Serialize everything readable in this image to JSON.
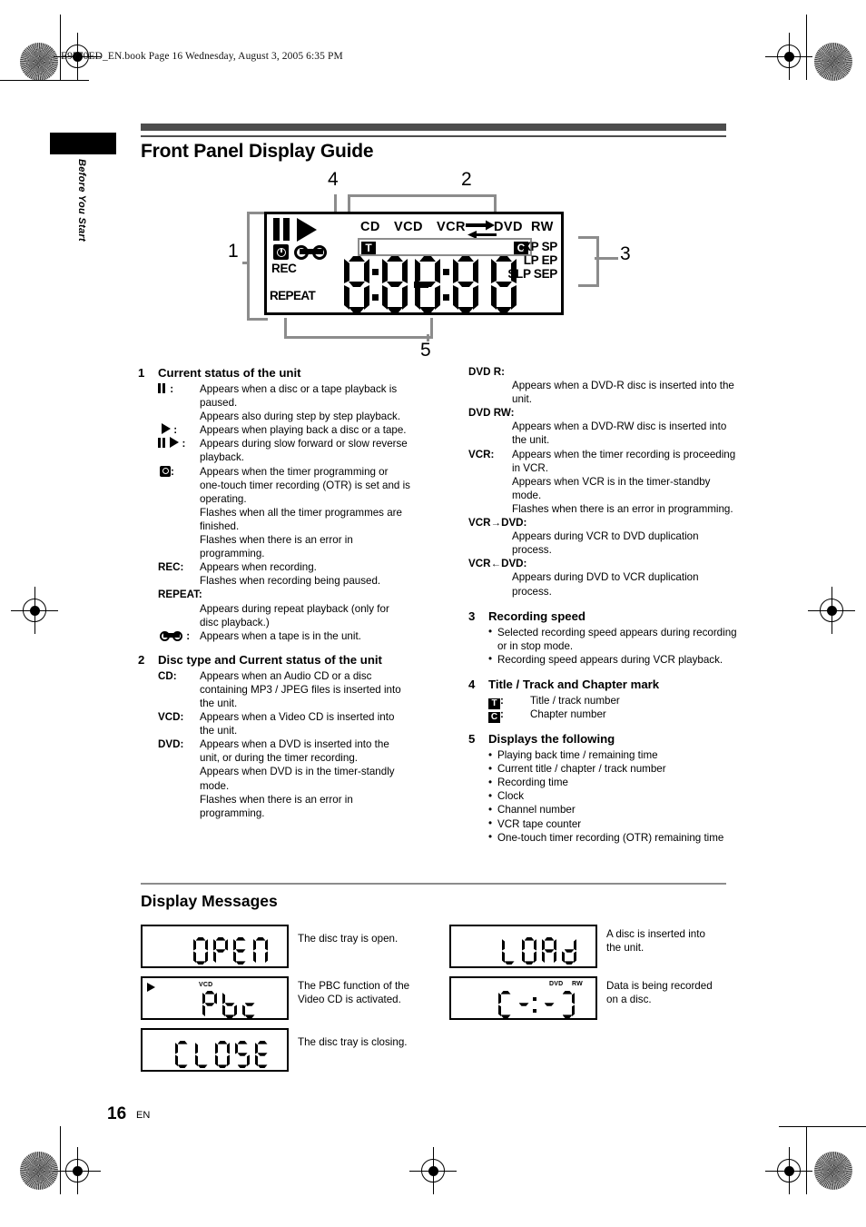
{
  "print_header": "E9770ED_EN.book  Page 16  Wednesday, August 3, 2005  6:35 PM",
  "sidebar_tab": "Before You Start",
  "title": "Front Panel Display Guide",
  "diagram": {
    "callouts": {
      "one": "1",
      "two": "2",
      "three": "3",
      "four": "4",
      "five": "5"
    },
    "top_markers": [
      "CD",
      "VCD",
      "VCR",
      "DVD",
      "RW"
    ],
    "left_labels": {
      "rec": "REC",
      "repeat": "REPEAT"
    },
    "title_mark": "T",
    "chapter_mark": "C",
    "speeds": [
      "XP SP",
      "LP EP",
      "SLP SEP"
    ],
    "icons": {
      "pause": "pause-icon",
      "play": "play-icon",
      "clock": "clock-icon",
      "tape": "tape-icon",
      "arrow_right": "arrow-right-icon",
      "arrow_left": "arrow-left-icon"
    }
  },
  "sections": {
    "s1": {
      "num": "1",
      "head": "Current status of the unit",
      "items": [
        {
          "icon": "pause",
          "term": " :",
          "lines": [
            "Appears when a disc or a tape playback is paused.",
            "Appears also during step by step playback."
          ]
        },
        {
          "icon": "play",
          "term": " :",
          "lines": [
            "Appears when playing back a disc or a tape."
          ]
        },
        {
          "icon": "pauseplay",
          "term": " :",
          "lines": [
            "Appears during slow forward or slow reverse playback."
          ]
        },
        {
          "icon": "clock",
          "term": ":",
          "lines": [
            "Appears when the timer programming or one-touch timer recording (OTR) is set and is operating.",
            "Flashes when all the timer programmes are finished.",
            "Flashes when there is an error in programming."
          ]
        },
        {
          "icon": "none",
          "term": "REC:",
          "lines": [
            "Appears when recording.",
            "Flashes when recording being paused."
          ]
        },
        {
          "icon": "none",
          "term": "REPEAT:",
          "block": true,
          "lines": [
            "Appears during repeat playback (only for disc playback.)"
          ]
        },
        {
          "icon": "tape",
          "term": " :",
          "lines": [
            "Appears when a tape is in the unit."
          ]
        }
      ]
    },
    "s2": {
      "num": "2",
      "head": "Disc type and Current status of the unit",
      "items_left": [
        {
          "term": "CD:",
          "lines": [
            "Appears when an Audio CD or a disc containing MP3 / JPEG files is inserted into the unit."
          ]
        },
        {
          "term": "VCD:",
          "lines": [
            "Appears when a Video CD is inserted into the unit."
          ]
        },
        {
          "term": "DVD:",
          "lines": [
            "Appears when a DVD is inserted into the unit, or during the timer recording.",
            "Appears when DVD is in the timer-standly mode.",
            "Flashes when there is an error in programming."
          ]
        }
      ],
      "items_right": [
        {
          "term": "DVD R:",
          "block": true,
          "lines": [
            "Appears when a DVD-R disc is inserted into the unit."
          ]
        },
        {
          "term": "DVD RW:",
          "block": true,
          "lines": [
            "Appears when a DVD-RW disc is inserted into the unit."
          ]
        },
        {
          "term": "VCR:",
          "lines": [
            "Appears when the timer recording is proceeding in VCR.",
            "Appears when VCR is in the timer-standby mode.",
            "Flashes when there is an error in programming."
          ]
        },
        {
          "term": "VCR→DVD:",
          "block": true,
          "lines": [
            "Appears during VCR to DVD duplication process."
          ]
        },
        {
          "term": "VCR←DVD:",
          "block": true,
          "lines": [
            "Appears during DVD to VCR duplication process."
          ]
        }
      ]
    },
    "s3": {
      "num": "3",
      "head": "Recording speed",
      "bullets": [
        "Selected recording speed appears during recording or in stop mode.",
        "Recording speed appears during VCR playback."
      ]
    },
    "s4": {
      "num": "4",
      "head": "Title / Track and Chapter mark",
      "items": [
        {
          "mark": "T",
          "term": ":",
          "text": "Title / track number"
        },
        {
          "mark": "C",
          "term": ":",
          "text": "Chapter number"
        }
      ]
    },
    "s5": {
      "num": "5",
      "head": "Displays the following",
      "bullets": [
        "Playing back time / remaining time",
        "Current title / chapter / track number",
        "Recording time",
        "Clock",
        "Channel number",
        "VCR tape counter",
        "One-touch timer recording (OTR) remaining time"
      ]
    }
  },
  "display_messages": {
    "heading": "Display Messages",
    "left": [
      {
        "lcd_text": "OPEN",
        "indicators": [],
        "description": "The disc tray is open."
      },
      {
        "lcd_text": "Pbc",
        "indicators": [
          "VCD"
        ],
        "play_icon": true,
        "description": "The PBC function of the Video CD is activated."
      },
      {
        "lcd_text": "CLOSE",
        "indicators": [],
        "description": "The disc tray is closing."
      }
    ],
    "right": [
      {
        "lcd_text": "LOAd",
        "indicators": [],
        "description": "A disc is inserted into the unit."
      },
      {
        "lcd_text": "[--:--]",
        "indicators": [
          "DVD",
          "RW"
        ],
        "description": "Data is being recorded on a disc."
      }
    ]
  },
  "footer": {
    "page_number": "16",
    "language": "EN"
  }
}
